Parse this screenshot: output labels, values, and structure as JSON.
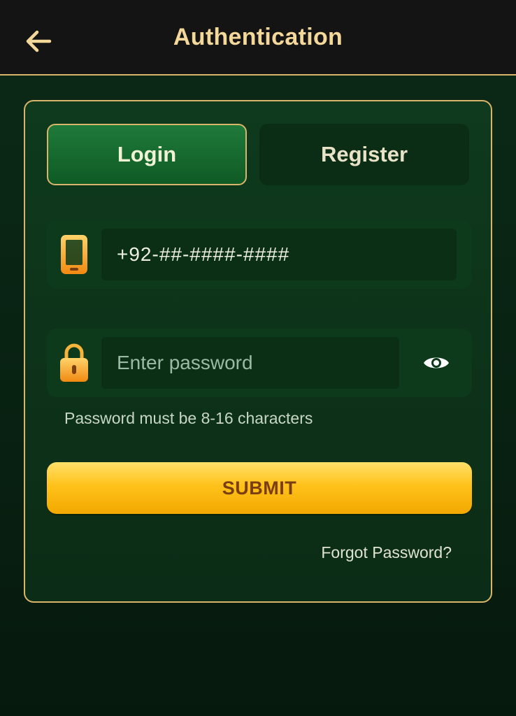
{
  "header": {
    "title": "Authentication",
    "back_icon": "arrow-left-icon"
  },
  "tabs": [
    {
      "label": "Login",
      "active": true
    },
    {
      "label": "Register",
      "active": false
    }
  ],
  "phone_field": {
    "icon": "mobile-phone-icon",
    "value": "+92-##-####-####"
  },
  "password_field": {
    "icon": "lock-icon",
    "placeholder": "Enter password",
    "toggle_icon": "eye-icon"
  },
  "password_hint": "Password must be 8-16 characters",
  "submit_label": "SUBMIT",
  "forgot_password_label": "Forgot Password?",
  "colors": {
    "accent_gold": "#d8b56a",
    "header_bg": "#141414",
    "page_bg": "#0a2213",
    "submit_gradient_top": "#ffe06a",
    "submit_gradient_bottom": "#f2a800",
    "active_tab": "#1f7a3a"
  }
}
